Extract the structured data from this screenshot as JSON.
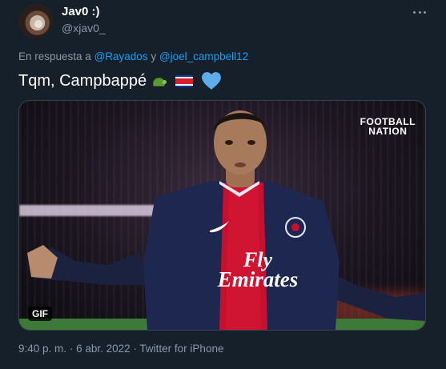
{
  "tweet": {
    "author_name": "Jav0 :)",
    "author_handle": "@xjav0_",
    "reply_prefix": "En respuesta a",
    "reply_to_1": "@Rayados",
    "reply_sep": "y",
    "reply_to_2": "@joel_campbell12",
    "text": "Tqm, Campbappé",
    "emojis": [
      "turtle-emoji",
      "costa-rica-flag-emoji",
      "blue-heart-emoji"
    ],
    "media_badge": "GIF",
    "media_watermark_line1": "FOOTBALL",
    "media_watermark_line2": "NATION",
    "media_jersey_line1": "Fly",
    "media_jersey_line2": "Emirates",
    "time": "9:40 p. m.",
    "date": "6 abr. 2022",
    "source": "Twitter for iPhone",
    "meta_separator": "·"
  },
  "colors": {
    "background": "#15202b",
    "secondary_text": "#8b98a5",
    "link": "#1d9bf0",
    "border": "#38444d"
  },
  "icons": {
    "more": "more-horizontal-icon"
  }
}
